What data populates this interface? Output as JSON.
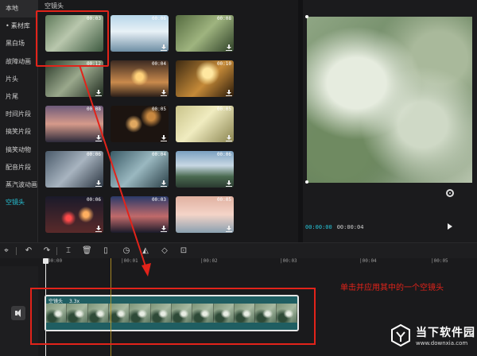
{
  "sidebar": {
    "items": [
      "本地",
      "素材库",
      "黑白场",
      "故障动画",
      "片头",
      "片尾",
      "时间片段",
      "搞笑片段",
      "搞笑动物",
      "配音片段",
      "蒸汽波动画",
      "空镜头"
    ]
  },
  "library": {
    "section_title": "空镜头",
    "thumbs": [
      {
        "duration": "00:03"
      },
      {
        "duration": "00:06"
      },
      {
        "duration": "00:08"
      },
      {
        "duration": "00:12"
      },
      {
        "duration": "00:04"
      },
      {
        "duration": "00:10"
      },
      {
        "duration": "00:08"
      },
      {
        "duration": "00:05"
      },
      {
        "duration": "00:05"
      },
      {
        "duration": "00:06"
      },
      {
        "duration": "00:04"
      },
      {
        "duration": "00:06"
      },
      {
        "duration": "00:06"
      },
      {
        "duration": "00:03"
      },
      {
        "duration": "00:05"
      }
    ]
  },
  "preview": {
    "current_time": "00:00:00",
    "total_time": "00:00:04"
  },
  "ruler": {
    "labels": [
      "00:00",
      "|00:01",
      "|00:02",
      "|00:03",
      "|00:04",
      "|00:05"
    ]
  },
  "clip": {
    "name": "空镜头",
    "speed": "3.3x"
  },
  "annotation": "单击并应用其中的一个空镜头",
  "watermark": {
    "cn": "当下软件园",
    "en": "www.downxia.com"
  },
  "colors": {
    "accent": "#26c6da",
    "highlight_red": "#e2231a",
    "clip_teal": "#1f5e62"
  }
}
